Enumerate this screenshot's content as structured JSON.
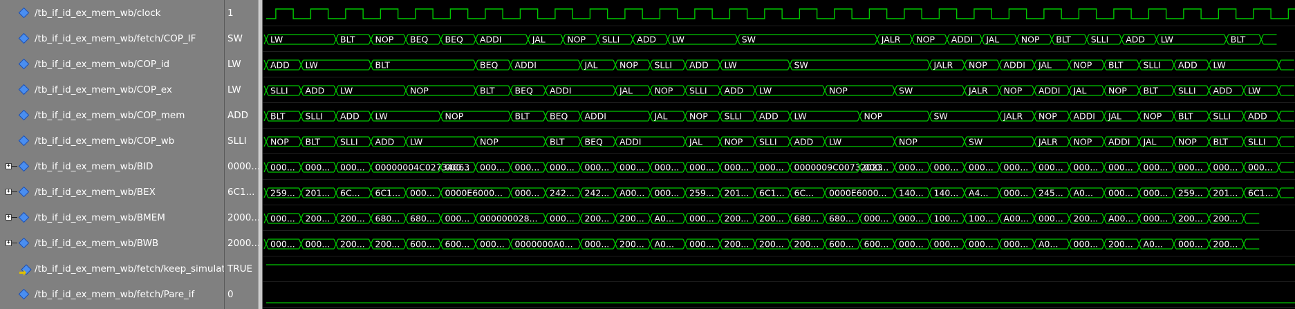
{
  "signals": [
    {
      "name": "/tb_if_id_ex_mem_wb/clock",
      "value": "1",
      "expandable": false,
      "icon": "diamond-icon"
    },
    {
      "name": "/tb_if_id_ex_mem_wb/fetch/COP_IF",
      "value": "SW",
      "expandable": false,
      "icon": "diamond-icon"
    },
    {
      "name": "/tb_if_id_ex_mem_wb/COP_id",
      "value": "LW",
      "expandable": false,
      "icon": "diamond-icon"
    },
    {
      "name": "/tb_if_id_ex_mem_wb/COP_ex",
      "value": "LW",
      "expandable": false,
      "icon": "diamond-icon"
    },
    {
      "name": "/tb_if_id_ex_mem_wb/COP_mem",
      "value": "ADD",
      "expandable": false,
      "icon": "diamond-icon"
    },
    {
      "name": "/tb_if_id_ex_mem_wb/COP_wb",
      "value": "SLLI",
      "expandable": false,
      "icon": "diamond-icon"
    },
    {
      "name": "/tb_if_id_ex_mem_wb/BID",
      "value": "0000...",
      "expandable": true,
      "icon": "diamond-icon"
    },
    {
      "name": "/tb_if_id_ex_mem_wb/BEX",
      "value": "6C1...",
      "expandable": true,
      "icon": "diamond-icon"
    },
    {
      "name": "/tb_if_id_ex_mem_wb/BMEM",
      "value": "2000...",
      "expandable": true,
      "icon": "diamond-icon"
    },
    {
      "name": "/tb_if_id_ex_mem_wb/BWB",
      "value": "2000...",
      "expandable": true,
      "icon": "diamond-icon"
    },
    {
      "name": "/tb_if_id_ex_mem_wb/fetch/keep_simulating",
      "value": "TRUE",
      "expandable": false,
      "icon": "input-arrow-icon"
    },
    {
      "name": "/tb_if_id_ex_mem_wb/fetch/Pare_if",
      "value": "0",
      "expandable": false,
      "icon": "diamond-icon"
    }
  ],
  "waves": {
    "clock": {
      "period_cycles": 1,
      "edges_start_high": false
    },
    "buses": [
      {
        "row": 1,
        "segments": [
          [
            "LW",
            2
          ],
          [
            "BLT",
            1
          ],
          [
            "NOP",
            1
          ],
          [
            "BEQ",
            1
          ],
          [
            "BEQ",
            1
          ],
          [
            "ADDI",
            1.5
          ],
          [
            "JAL",
            1
          ],
          [
            "NOP",
            1
          ],
          [
            "SLLI",
            1
          ],
          [
            "ADD",
            1
          ],
          [
            "LW",
            2
          ],
          [
            "SW",
            4
          ],
          [
            "JALR",
            1
          ],
          [
            "NOP",
            1
          ],
          [
            "ADDI",
            1
          ],
          [
            "JAL",
            1
          ],
          [
            "NOP",
            1
          ],
          [
            "BLT",
            1
          ],
          [
            "SLLI",
            1
          ],
          [
            "ADD",
            1
          ],
          [
            "LW",
            2
          ],
          [
            "BLT",
            1
          ],
          [
            "",
            0.5
          ]
        ]
      },
      {
        "row": 2,
        "segments": [
          [
            "ADD",
            1
          ],
          [
            "LW",
            2
          ],
          [
            "BLT",
            3
          ],
          [
            "BEQ",
            1
          ],
          [
            "ADDI",
            2
          ],
          [
            "JAL",
            1
          ],
          [
            "NOP",
            1
          ],
          [
            "SLLI",
            1
          ],
          [
            "ADD",
            1
          ],
          [
            "LW",
            2
          ],
          [
            "SW",
            4
          ],
          [
            "JALR",
            1
          ],
          [
            "NOP",
            1
          ],
          [
            "ADDI",
            1
          ],
          [
            "JAL",
            1
          ],
          [
            "NOP",
            1
          ],
          [
            "BLT",
            1
          ],
          [
            "SLLI",
            1
          ],
          [
            "ADD",
            1
          ],
          [
            "LW",
            2
          ],
          [
            "",
            0.5
          ]
        ]
      },
      {
        "row": 3,
        "segments": [
          [
            "SLLI",
            1
          ],
          [
            "ADD",
            1
          ],
          [
            "LW",
            2
          ],
          [
            "NOP",
            2
          ],
          [
            "BLT",
            1
          ],
          [
            "BEQ",
            1
          ],
          [
            "ADDI",
            2
          ],
          [
            "JAL",
            1
          ],
          [
            "NOP",
            1
          ],
          [
            "SLLI",
            1
          ],
          [
            "ADD",
            1
          ],
          [
            "LW",
            2
          ],
          [
            "NOP",
            2
          ],
          [
            "SW",
            2
          ],
          [
            "JALR",
            1
          ],
          [
            "NOP",
            1
          ],
          [
            "ADDI",
            1
          ],
          [
            "JAL",
            1
          ],
          [
            "NOP",
            1
          ],
          [
            "BLT",
            1
          ],
          [
            "SLLI",
            1
          ],
          [
            "ADD",
            1
          ],
          [
            "LW",
            1
          ],
          [
            "",
            0.5
          ]
        ]
      },
      {
        "row": 4,
        "segments": [
          [
            "BLT",
            1
          ],
          [
            "SLLI",
            1
          ],
          [
            "ADD",
            1
          ],
          [
            "LW",
            2
          ],
          [
            "NOP",
            2
          ],
          [
            "BLT",
            1
          ],
          [
            "BEQ",
            1
          ],
          [
            "ADDI",
            2
          ],
          [
            "JAL",
            1
          ],
          [
            "NOP",
            1
          ],
          [
            "SLLI",
            1
          ],
          [
            "ADD",
            1
          ],
          [
            "LW",
            2
          ],
          [
            "NOP",
            2
          ],
          [
            "SW",
            2
          ],
          [
            "JALR",
            1
          ],
          [
            "NOP",
            1
          ],
          [
            "ADDI",
            1
          ],
          [
            "JAL",
            1
          ],
          [
            "NOP",
            1
          ],
          [
            "BLT",
            1
          ],
          [
            "SLLI",
            1
          ],
          [
            "ADD",
            1
          ],
          [
            "",
            0.5
          ]
        ]
      },
      {
        "row": 5,
        "segments": [
          [
            "NOP",
            1
          ],
          [
            "BLT",
            1
          ],
          [
            "SLLI",
            1
          ],
          [
            "ADD",
            1
          ],
          [
            "LW",
            2
          ],
          [
            "NOP",
            2
          ],
          [
            "BLT",
            1
          ],
          [
            "BEQ",
            1
          ],
          [
            "ADDI",
            2
          ],
          [
            "JAL",
            1
          ],
          [
            "NOP",
            1
          ],
          [
            "SLLI",
            1
          ],
          [
            "ADD",
            1
          ],
          [
            "LW",
            2
          ],
          [
            "NOP",
            2
          ],
          [
            "SW",
            2
          ],
          [
            "JALR",
            1
          ],
          [
            "NOP",
            1
          ],
          [
            "ADDI",
            1
          ],
          [
            "JAL",
            1
          ],
          [
            "NOP",
            1
          ],
          [
            "BLT",
            1
          ],
          [
            "SLLI",
            1
          ],
          [
            "",
            0.5
          ]
        ]
      },
      {
        "row": 6,
        "segments": [
          [
            "000...",
            1
          ],
          [
            "000...",
            1
          ],
          [
            "000...",
            1
          ],
          [
            "00000004C02734C63",
            2
          ],
          [
            "000...",
            1
          ],
          [
            "000...",
            1
          ],
          [
            "000...",
            1
          ],
          [
            "000...",
            1
          ],
          [
            "000...",
            1
          ],
          [
            "000...",
            1
          ],
          [
            "000...",
            1
          ],
          [
            "000...",
            1
          ],
          [
            "000...",
            1
          ],
          [
            "000...",
            1
          ],
          [
            "0000009C00732023",
            2
          ],
          [
            "000...",
            1
          ],
          [
            "000...",
            1
          ],
          [
            "000...",
            1
          ],
          [
            "000...",
            1
          ],
          [
            "000...",
            1
          ],
          [
            "000...",
            1
          ],
          [
            "000...",
            1
          ],
          [
            "000...",
            1
          ],
          [
            "000...",
            1
          ],
          [
            "000...",
            1
          ],
          [
            "000...",
            1
          ],
          [
            "000...",
            1
          ],
          [
            "",
            0.5
          ]
        ]
      },
      {
        "row": 7,
        "segments": [
          [
            "259...",
            1
          ],
          [
            "201...",
            1
          ],
          [
            "6C...",
            1
          ],
          [
            "6C1...",
            1
          ],
          [
            "000...",
            1
          ],
          [
            "0000E6000...",
            2
          ],
          [
            "000...",
            1
          ],
          [
            "242...",
            1
          ],
          [
            "242...",
            1
          ],
          [
            "A00...",
            1
          ],
          [
            "000...",
            1
          ],
          [
            "259...",
            1
          ],
          [
            "201...",
            1
          ],
          [
            "6C1...",
            1
          ],
          [
            "6C...",
            1
          ],
          [
            "0000E6000...",
            2
          ],
          [
            "140...",
            1
          ],
          [
            "140...",
            1
          ],
          [
            "A4...",
            1
          ],
          [
            "000...",
            1
          ],
          [
            "245...",
            1
          ],
          [
            "A0...",
            1
          ],
          [
            "000...",
            1
          ],
          [
            "000...",
            1
          ],
          [
            "259...",
            1
          ],
          [
            "201...",
            1
          ],
          [
            "6C1...",
            1
          ],
          [
            "",
            0.5
          ]
        ]
      },
      {
        "row": 8,
        "segments": [
          [
            "000...",
            1
          ],
          [
            "200...",
            1
          ],
          [
            "200...",
            1
          ],
          [
            "680...",
            1
          ],
          [
            "680...",
            1
          ],
          [
            "000...",
            1
          ],
          [
            "000000028...",
            2
          ],
          [
            "000...",
            1
          ],
          [
            "200...",
            1
          ],
          [
            "200...",
            1
          ],
          [
            "A0...",
            1
          ],
          [
            "000...",
            1
          ],
          [
            "200...",
            1
          ],
          [
            "200...",
            1
          ],
          [
            "680...",
            1
          ],
          [
            "680...",
            1
          ],
          [
            "000...",
            1
          ],
          [
            "000...",
            1
          ],
          [
            "100...",
            1
          ],
          [
            "100...",
            1
          ],
          [
            "A00...",
            1
          ],
          [
            "000...",
            1
          ],
          [
            "200...",
            1
          ],
          [
            "A00...",
            1
          ],
          [
            "000...",
            1
          ],
          [
            "200...",
            1
          ],
          [
            "200...",
            1
          ],
          [
            "",
            0.5
          ]
        ]
      },
      {
        "row": 9,
        "segments": [
          [
            "000...",
            1
          ],
          [
            "000...",
            1
          ],
          [
            "200...",
            1
          ],
          [
            "200...",
            1
          ],
          [
            "600...",
            1
          ],
          [
            "600...",
            1
          ],
          [
            "000...",
            1
          ],
          [
            "0000000A0...",
            2
          ],
          [
            "000...",
            1
          ],
          [
            "200...",
            1
          ],
          [
            "A0...",
            1
          ],
          [
            "000...",
            1
          ],
          [
            "200...",
            1
          ],
          [
            "200...",
            1
          ],
          [
            "200...",
            1
          ],
          [
            "600...",
            1
          ],
          [
            "600...",
            1
          ],
          [
            "000...",
            1
          ],
          [
            "000...",
            1
          ],
          [
            "000...",
            1
          ],
          [
            "000...",
            1
          ],
          [
            "A0...",
            1
          ],
          [
            "000...",
            1
          ],
          [
            "200...",
            1
          ],
          [
            "A0...",
            1
          ],
          [
            "000...",
            1
          ],
          [
            "200...",
            1
          ],
          [
            "",
            0.5
          ]
        ]
      }
    ],
    "flat_rows": [
      {
        "row": 10,
        "level": "high"
      },
      {
        "row": 11,
        "level": "low"
      }
    ],
    "colors": {
      "wave": "#00c800",
      "text": "#ffffff",
      "grid": "#00c800",
      "background": "#000000"
    }
  }
}
